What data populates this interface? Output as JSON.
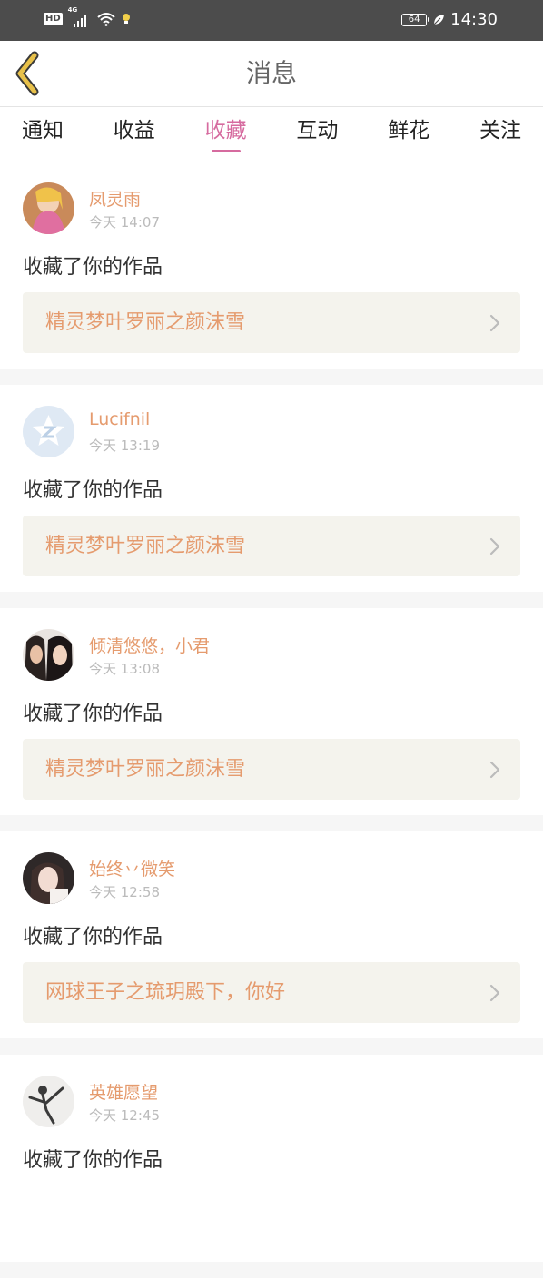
{
  "status_bar": {
    "hd": "HD",
    "network": "4G",
    "battery": "64",
    "time": "14:30"
  },
  "header": {
    "title": "消息"
  },
  "tabs": [
    {
      "label": "通知"
    },
    {
      "label": "收益"
    },
    {
      "label": "收藏"
    },
    {
      "label": "互动"
    },
    {
      "label": "鲜花"
    },
    {
      "label": "关注"
    }
  ],
  "active_tab": "收藏",
  "notifications": [
    {
      "user": "凤灵雨",
      "time": "今天 14:07",
      "action": "收藏了你的作品",
      "work": "精灵梦叶罗丽之颜沫雪"
    },
    {
      "user": "Lucifnil",
      "time": "今天 13:19",
      "action": "收藏了你的作品",
      "work": "精灵梦叶罗丽之颜沫雪"
    },
    {
      "user": "倾清悠悠，小君",
      "time": "今天 13:08",
      "action": "收藏了你的作品",
      "work": "精灵梦叶罗丽之颜沫雪"
    },
    {
      "user": "始终丷微笑",
      "time": "今天 12:58",
      "action": "收藏了你的作品",
      "work": "网球王子之琉玥殿下，你好"
    },
    {
      "user": "英雄愿望",
      "time": "今天 12:45",
      "action": "收藏了你的作品",
      "work": ""
    }
  ],
  "colors": {
    "accent_pink": "#d66b9f",
    "name_orange": "#e59b6e",
    "link_bg": "#f4f3ed",
    "status_bar_bg": "#4c4c4c",
    "back_arrow": "#e8c14a"
  }
}
